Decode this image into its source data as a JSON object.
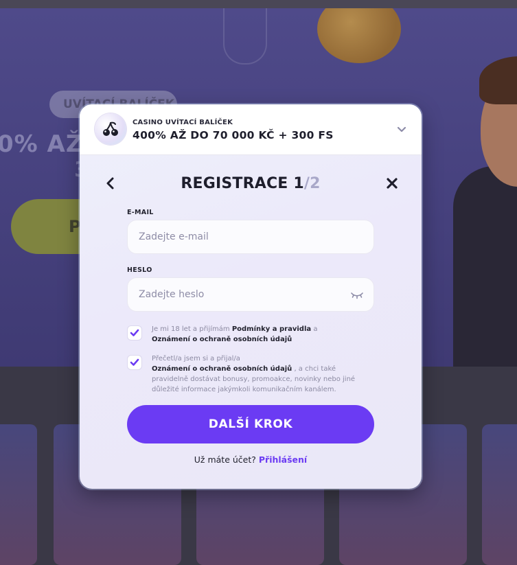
{
  "background": {
    "badge": "UVÍTACÍ BALÍČEK",
    "headline": "0% AŽ",
    "headline_2": "3",
    "cta_fragment": "P"
  },
  "bonus": {
    "kicker": "CASINO UVÍTACÍ BALÍČEK",
    "title": "400% AŽ DO 70 000 KČ + 300 FS",
    "icon": "cherry-icon",
    "toggle_icon": "chevron-down-icon"
  },
  "registration": {
    "title": "REGISTRACE",
    "step_current": "1",
    "step_total": "/2",
    "back_icon": "chevron-left-icon",
    "close_icon": "close-icon"
  },
  "email": {
    "label": "E-MAIL",
    "placeholder": "Zadejte e-mail",
    "value": ""
  },
  "password": {
    "label": "HESLO",
    "placeholder": "Zadejte heslo",
    "value": "",
    "toggle_icon": "eye-closed-icon"
  },
  "consents": [
    {
      "checked": true,
      "text_before": "Je mi 18 let a přijímám",
      "link_1": "Podmínky a pravidla",
      "text_mid": "a",
      "link_2": "Oznámení o ochraně osobních údajů"
    },
    {
      "checked": true,
      "text_before": "Přečetl/a jsem si a přijal/a",
      "link_1": "Oznámení o ochraně osobních údajů",
      "text_after": ", a chci také pravidelně dostávat bonusy, promoakce, novinky nebo jiné důležité informace jakýmkoli komunikačním kanálem."
    }
  ],
  "submit": {
    "label": "DALŠÍ KROK"
  },
  "login": {
    "prompt": "Už máte účet?",
    "link": "Přihlášení"
  },
  "colors": {
    "accent": "#6b3bf3",
    "heading": "#1e1e2c",
    "muted_step": "#a9a8c9"
  }
}
